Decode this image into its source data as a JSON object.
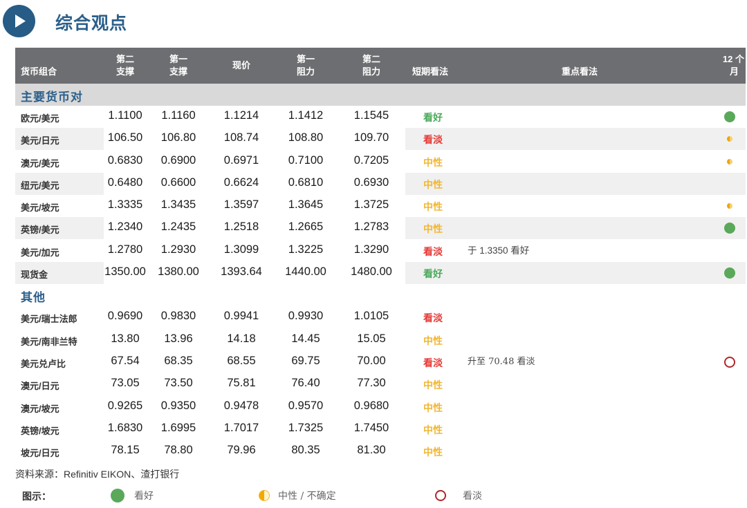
{
  "title": "综合观点",
  "icons": {
    "title_icon": "play-icon",
    "bullish": "filled-green-circle-icon",
    "neutral": "half-filled-orange-circle-icon",
    "bearish": "hollow-red-circle-icon"
  },
  "colors": {
    "header_bg": "#6d6e71",
    "section_bg": "#d9d9d9",
    "title_blue": "#2b5f8a",
    "bullish": "#4aa85a",
    "bearish": "#e53935",
    "neutral": "#f2b632",
    "bearish_circle": "#b0262b"
  },
  "table": {
    "headers": {
      "pair": "货币组合",
      "s2": [
        "第二",
        "支撑"
      ],
      "s1": [
        "第一",
        "支撑"
      ],
      "spot": "现价",
      "r1": [
        "第一",
        "阻力"
      ],
      "r2": [
        "第二",
        "阻力"
      ],
      "short_term": "短期看法",
      "key_view": "重点看法",
      "m12": [
        "12 个",
        "月"
      ]
    },
    "sections": [
      {
        "title": "主要货币对",
        "rows": [
          {
            "pair": "欧元/美元",
            "s2": "1.1100",
            "s1": "1.1160",
            "spot": "1.1214",
            "r1": "1.1412",
            "r2": "1.1545",
            "short_term": "看好",
            "short_class": "bull",
            "key_view": "",
            "m12": "bull"
          },
          {
            "pair": "美元/日元",
            "s2": "106.50",
            "s1": "106.80",
            "spot": "108.74",
            "r1": "108.80",
            "r2": "109.70",
            "short_term": "看淡",
            "short_class": "bear",
            "key_view": "",
            "m12": "neutral"
          },
          {
            "pair": "澳元/美元",
            "s2": "0.6830",
            "s1": "0.6900",
            "spot": "0.6971",
            "r1": "0.7100",
            "r2": "0.7205",
            "short_term": "中性",
            "short_class": "neutral",
            "key_view": "",
            "m12": "neutral"
          },
          {
            "pair": "纽元/美元",
            "s2": "0.6480",
            "s1": "0.6600",
            "spot": "0.6624",
            "r1": "0.6810",
            "r2": "0.6930",
            "short_term": "中性",
            "short_class": "neutral",
            "key_view": "",
            "m12": ""
          },
          {
            "pair": "美元/坡元",
            "s2": "1.3335",
            "s1": "1.3435",
            "spot": "1.3597",
            "r1": "1.3645",
            "r2": "1.3725",
            "short_term": "中性",
            "short_class": "neutral",
            "key_view": "",
            "m12": "neutral"
          },
          {
            "pair": "英镑/美元",
            "s2": "1.2340",
            "s1": "1.2435",
            "spot": "1.2518",
            "r1": "1.2665",
            "r2": "1.2783",
            "short_term": "中性",
            "short_class": "neutral",
            "key_view": "",
            "m12": "bull"
          },
          {
            "pair": "美元/加元",
            "s2": "1.2780",
            "s1": "1.2930",
            "spot": "1.3099",
            "r1": "1.3225",
            "r2": "1.3290",
            "short_term": "看淡",
            "short_class": "bear",
            "key_view": "于 1.3350 看好",
            "m12": ""
          },
          {
            "pair": "现货金",
            "s2": "1350.00",
            "s1": "1380.00",
            "spot": "1393.64",
            "r1": "1440.00",
            "r2": "1480.00",
            "short_term": "看好",
            "short_class": "bull",
            "key_view": "",
            "m12": "bull"
          }
        ]
      },
      {
        "title": "其他",
        "rows": [
          {
            "pair": "美元/瑞士法郎",
            "s2": "0.9690",
            "s1": "0.9830",
            "spot": "0.9941",
            "r1": "0.9930",
            "r2": "1.0105",
            "short_term": "看淡",
            "short_class": "bear",
            "key_view": "",
            "m12": ""
          },
          {
            "pair": "美元/南非兰特",
            "s2": "13.80",
            "s1": "13.96",
            "spot": "14.18",
            "r1": "14.45",
            "r2": "15.05",
            "short_term": "中性",
            "short_class": "neutral",
            "key_view": "",
            "m12": ""
          },
          {
            "pair": "美元兑卢比",
            "s2": "67.54",
            "s1": "68.35",
            "spot": "68.55",
            "r1": "69.75",
            "r2": "70.00",
            "short_term": "看淡",
            "short_class": "bear",
            "key_view": "升至 70.48 看淡",
            "m12": "bear"
          },
          {
            "pair": "澳元/日元",
            "s2": "73.05",
            "s1": "73.50",
            "spot": "75.81",
            "r1": "76.40",
            "r2": "77.30",
            "short_term": "中性",
            "short_class": "neutral",
            "key_view": "",
            "m12": ""
          },
          {
            "pair": "澳元/坡元",
            "s2": "0.9265",
            "s1": "0.9350",
            "spot": "0.9478",
            "r1": "0.9570",
            "r2": "0.9680",
            "short_term": "中性",
            "short_class": "neutral",
            "key_view": "",
            "m12": ""
          },
          {
            "pair": "英镑/坡元",
            "s2": "1.6830",
            "s1": "1.6995",
            "spot": "1.7017",
            "r1": "1.7325",
            "r2": "1.7450",
            "short_term": "中性",
            "short_class": "neutral",
            "key_view": "",
            "m12": ""
          },
          {
            "pair": "坡元/日元",
            "s2": "78.15",
            "s1": "78.80",
            "spot": "79.96",
            "r1": "80.35",
            "r2": "81.30",
            "short_term": "中性",
            "short_class": "neutral",
            "key_view": "",
            "m12": ""
          }
        ]
      }
    ]
  },
  "footer": {
    "source": "资料来源：Refinitiv EIKON、渣打银行",
    "legend_label": "图示：",
    "legend": [
      {
        "type": "bull",
        "label": "看好"
      },
      {
        "type": "neutral",
        "label": "中性 / 不确定"
      },
      {
        "type": "bear",
        "label": "看淡"
      }
    ]
  }
}
